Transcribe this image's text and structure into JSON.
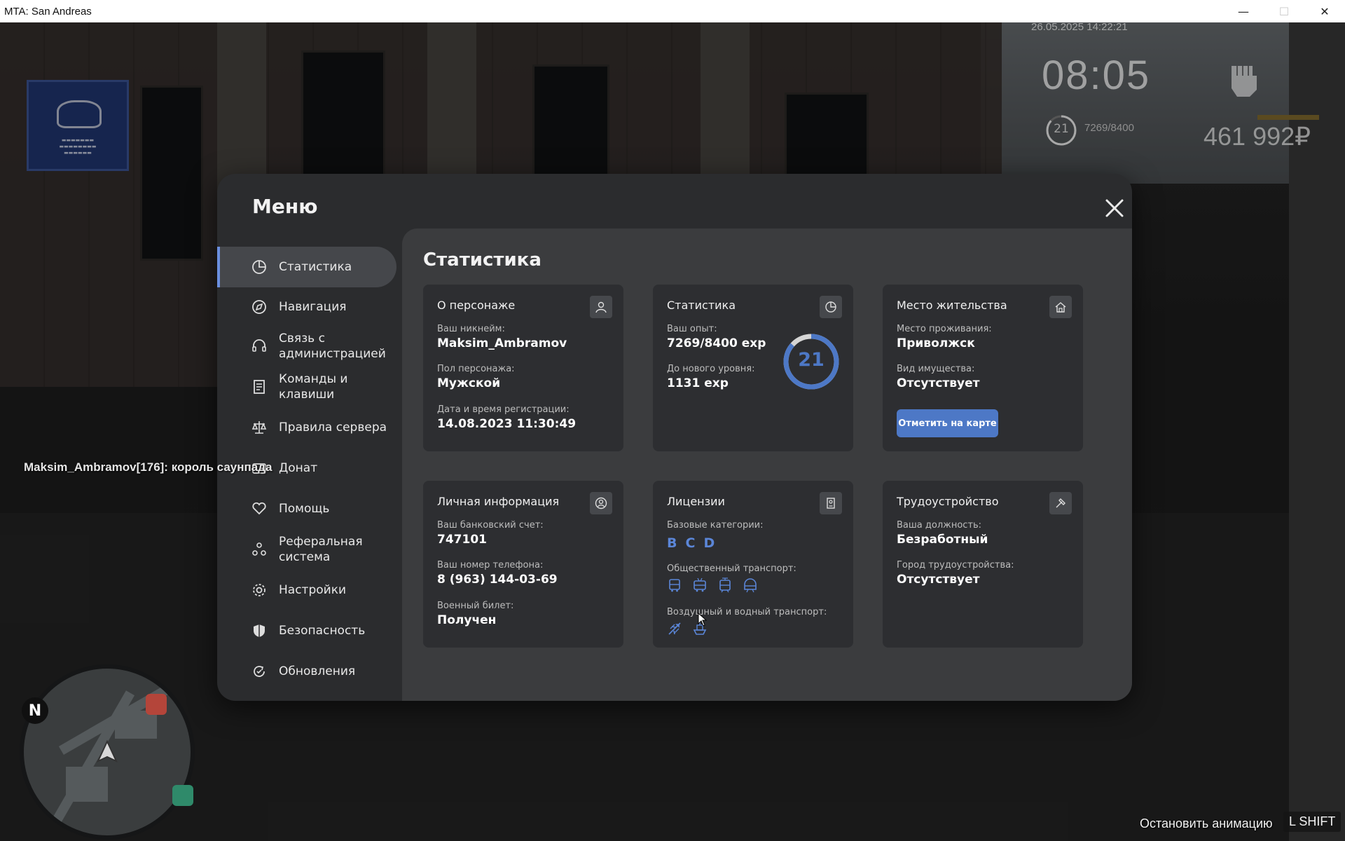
{
  "window": {
    "title": "MTA: San Andreas",
    "minimize": "—",
    "maximize": "☐",
    "close": "✕"
  },
  "hud": {
    "datetime": "26.05.2025 14:22:21",
    "clock": "08:05",
    "level": "21",
    "exp": "7269/8400",
    "money": "461 992₽"
  },
  "chat": {
    "line": "Maksim_Ambramov[176]: король саунпада"
  },
  "minimap": {
    "north": "N"
  },
  "hint": {
    "text": "Остановить анимацию",
    "key": "L SHIFT"
  },
  "menu": {
    "title": "Меню",
    "nav": [
      {
        "label": "Статистика",
        "icon": "pie-chart-icon",
        "active": true
      },
      {
        "label": "Навигация",
        "icon": "compass-icon"
      },
      {
        "label": "Связь с администрацией",
        "icon": "headset-icon"
      },
      {
        "label": "Команды и клавиши",
        "icon": "document-icon"
      },
      {
        "label": "Правила сервера",
        "icon": "scales-icon"
      },
      {
        "label": "Донат",
        "icon": "wallet-icon"
      },
      {
        "label": "Помощь",
        "icon": "heart-hand-icon"
      },
      {
        "label": "Реферальная система",
        "icon": "people-icon"
      },
      {
        "label": "Настройки",
        "icon": "gear-icon"
      },
      {
        "label": "Безопасность",
        "icon": "shield-icon"
      },
      {
        "label": "Обновления",
        "icon": "refresh-icon"
      }
    ],
    "page_title": "Статистика",
    "cards": {
      "character": {
        "title": "О персонаже",
        "nick_label": "Ваш никнейм:",
        "nick": "Maksim_Ambramov",
        "gender_label": "Пол персонажа:",
        "gender": "Мужской",
        "reg_label": "Дата и время регистрации:",
        "reg": "14.08.2023 11:30:49"
      },
      "stats": {
        "title": "Статистика",
        "exp_label": "Ваш опыт:",
        "exp": "7269/8400 exp",
        "next_label": "До нового уровня:",
        "next": "1131 exp",
        "level": "21",
        "progress": 0.865
      },
      "residence": {
        "title": "Место жительства",
        "place_label": "Место проживания:",
        "place": "Приволжск",
        "property_label": "Вид имущества:",
        "property": "Отсутствует",
        "button": "Отметить на карте"
      },
      "personal": {
        "title": "Личная информация",
        "bank_label": "Ваш банковский счет:",
        "bank": "747101",
        "phone_label": "Ваш номер телефона:",
        "phone": "8 (963) 144-03-69",
        "military_label": "Военный билет:",
        "military": "Получен"
      },
      "licenses": {
        "title": "Лицензии",
        "base_label": "Базовые категории:",
        "base": [
          "B",
          "C",
          "D"
        ],
        "public_label": "Общественный транспорт:",
        "public_icons": [
          "bus-icon",
          "trolleybus-icon",
          "tram-icon",
          "metro-icon"
        ],
        "air_label": "Воздушный и водный транспорт:",
        "air_icons": [
          "plane-icon",
          "boat-icon"
        ]
      },
      "employment": {
        "title": "Трудоустройство",
        "position_label": "Ваша должность:",
        "position": "Безработный",
        "city_label": "Город трудоустройства:",
        "city": "Отсутствует"
      }
    }
  },
  "colors": {
    "accent": "#4d78c6",
    "active_bar": "#6b8fe0",
    "panel": "#2b2c2e",
    "content": "#3b3c3e",
    "card": "#2d2e31"
  }
}
